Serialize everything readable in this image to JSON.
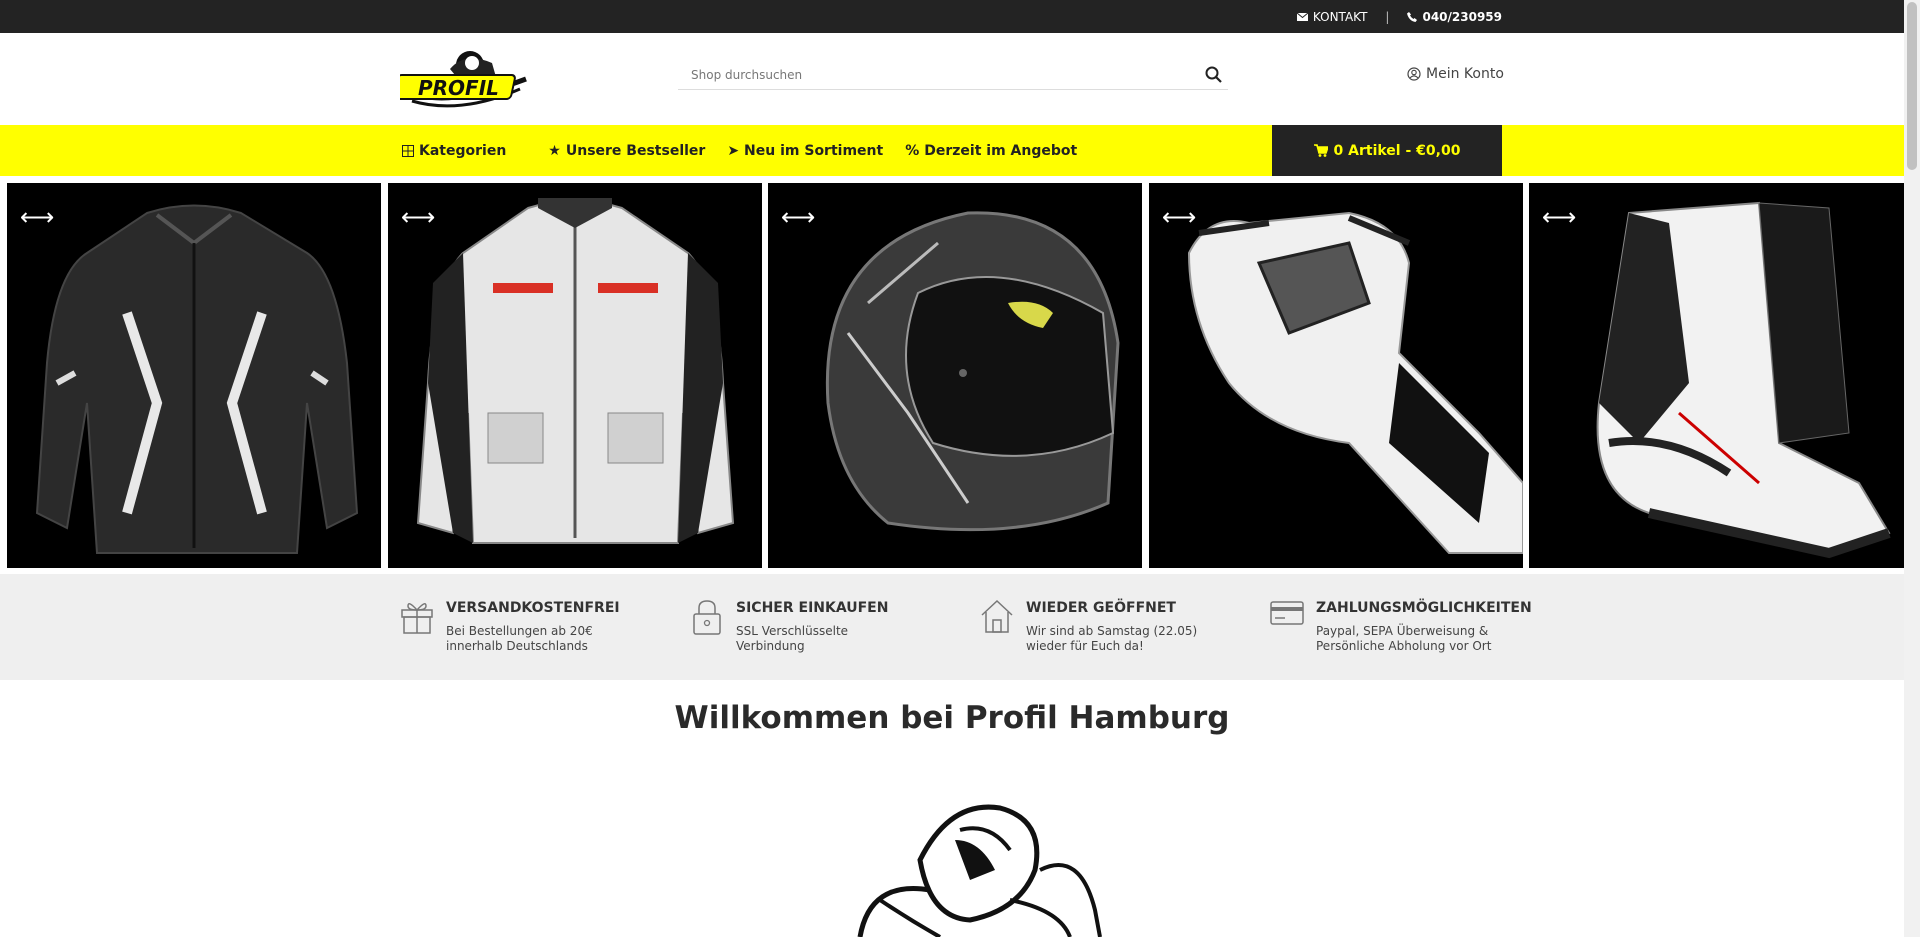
{
  "topbar": {
    "contact_label": "KONTAKT",
    "separator": "|",
    "phone": "040/230959"
  },
  "header": {
    "logo_text": "PROFIL",
    "search_placeholder": "Shop durchsuchen",
    "account_label": "Mein Konto"
  },
  "nav": {
    "items": [
      {
        "label": "Kategorien",
        "icon": "grid-icon"
      },
      {
        "label": "Unsere Bestseller",
        "icon": "star-icon"
      },
      {
        "label": "Neu im Sortiment",
        "icon": "arrow-icon"
      },
      {
        "label": "Derzeit im Angebot",
        "icon": "percent-icon"
      }
    ],
    "star_glyph": "★",
    "arrow_glyph": "➤",
    "percent_glyph": "%",
    "cart_label": "0 Artikel - €0,00"
  },
  "slider": {
    "slides": [
      {
        "product": "leather jacket"
      },
      {
        "product": "textile jacket"
      },
      {
        "product": "helmet"
      },
      {
        "product": "glove"
      },
      {
        "product": "boots"
      }
    ],
    "arrow_glyph": "⟷"
  },
  "features": [
    {
      "title": "VERSANDKOSTENFREI",
      "line1": "Bei Bestellungen ab 20€",
      "line2": "innerhalb Deutschlands",
      "icon": "gift-icon"
    },
    {
      "title": "SICHER EINKAUFEN",
      "line1": "SSL Verschlüsselte",
      "line2": "Verbindung",
      "icon": "lock-icon"
    },
    {
      "title": "WIEDER GEÖFFNET",
      "line1": "Wir sind ab Samstag (22.05)",
      "line2": "wieder für Euch da!",
      "icon": "home-icon"
    },
    {
      "title": "ZAHLUNGSMÖGLICHKEITEN",
      "line1": "Paypal, SEPA Überweisung &",
      "line2": "Persönliche Abholung vor Ort",
      "icon": "credit-card-icon"
    }
  ],
  "welcome": {
    "heading": "Willkommen bei Profil Hamburg"
  },
  "colors": {
    "accent_yellow": "#ffff00",
    "dark": "#232323"
  }
}
